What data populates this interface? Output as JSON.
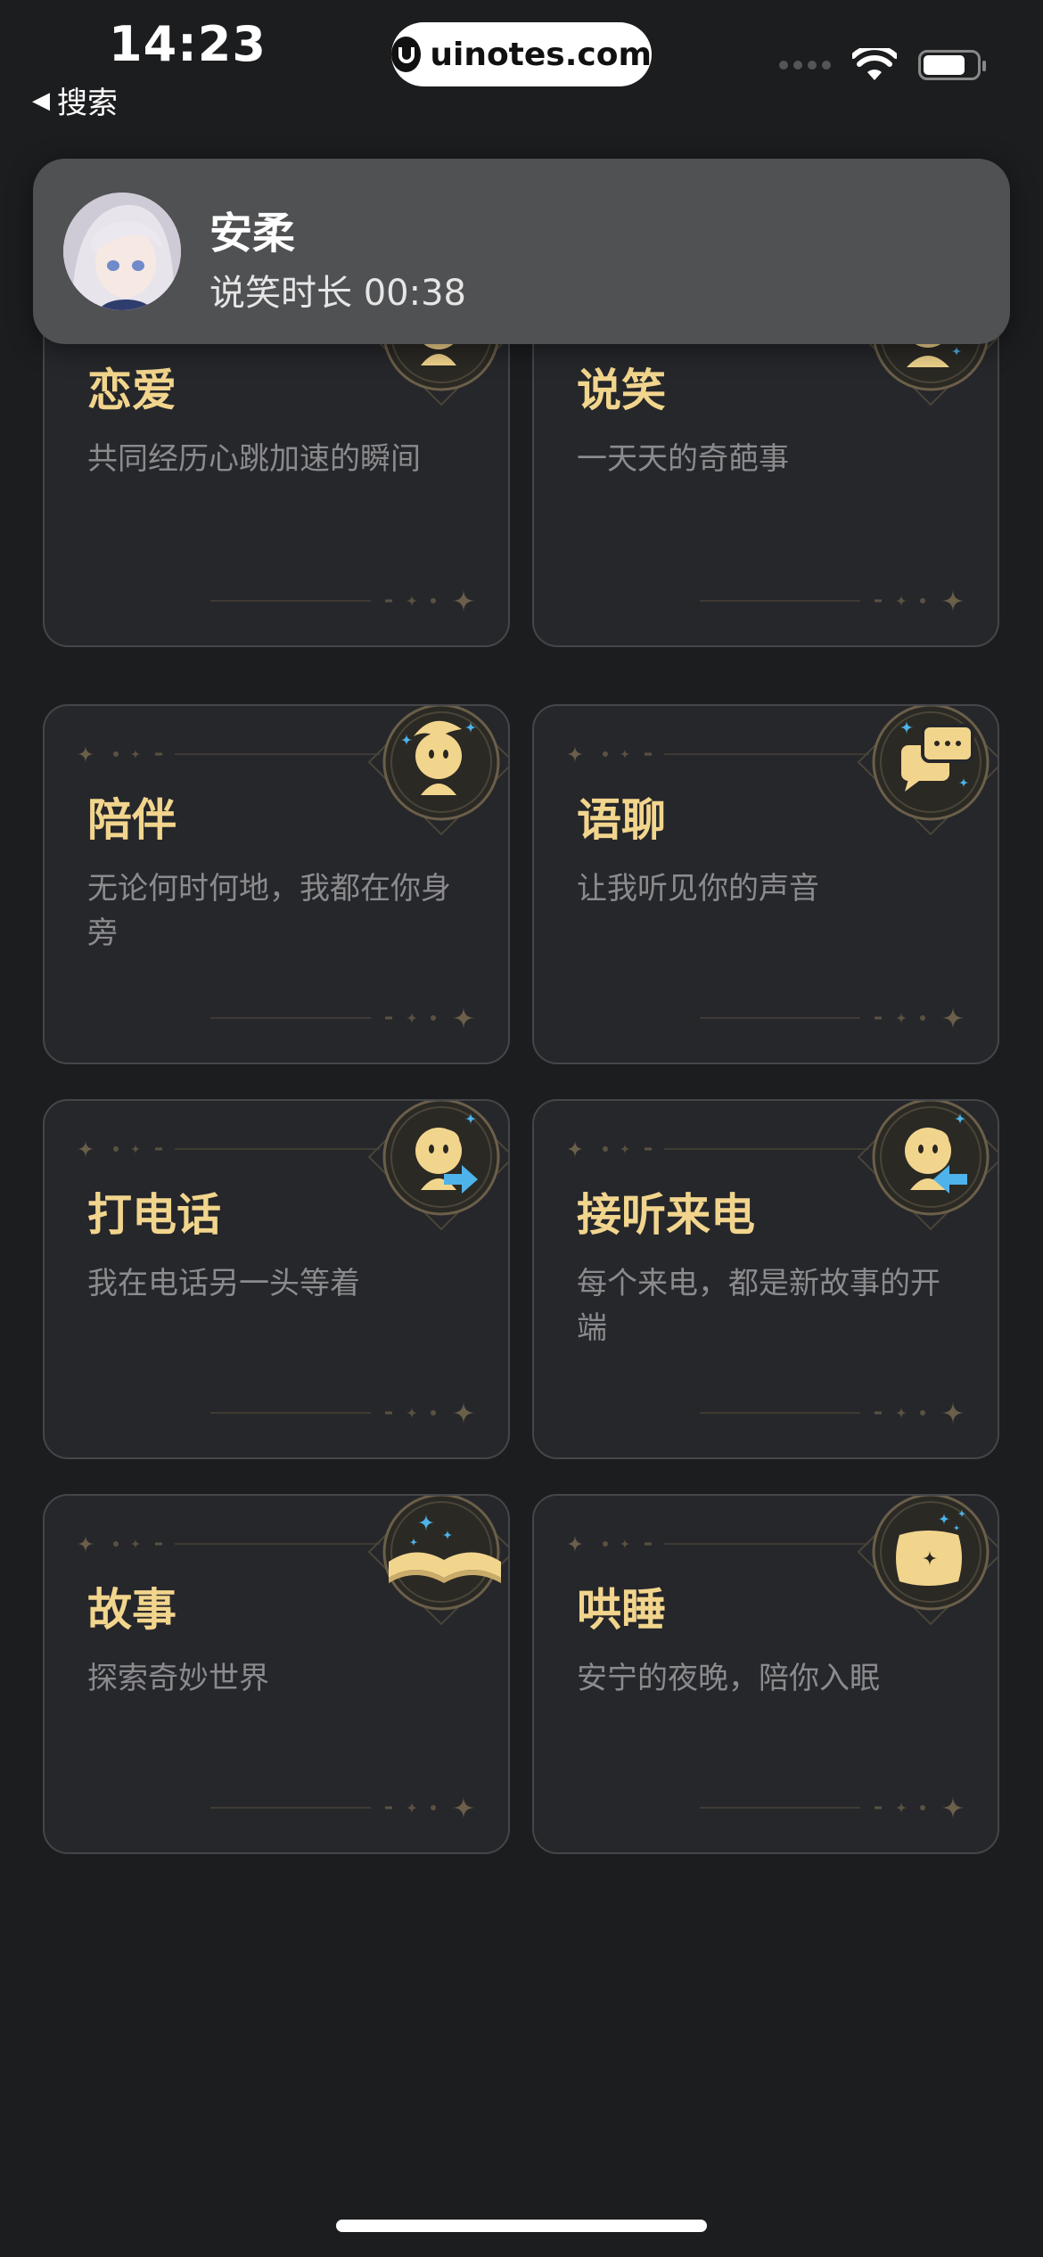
{
  "status_bar": {
    "time": "14:23",
    "back_label": "搜索",
    "watermark": "uinotes.com"
  },
  "notification": {
    "name": "安柔",
    "subtitle": "说笑时长 00:38"
  },
  "cards": [
    {
      "title": "恋爱",
      "desc": "共同经历心跳加速的瞬间",
      "icon": "love-figure-icon"
    },
    {
      "title": "说笑",
      "desc": "一天天的奇葩事",
      "icon": "laughing-figure-icon"
    },
    {
      "title": "陪伴",
      "desc": "无论何时何地，我都在你身旁",
      "icon": "companion-figure-icon"
    },
    {
      "title": "语聊",
      "desc": "让我听见你的声音",
      "icon": "chat-bubbles-icon"
    },
    {
      "title": "打电话",
      "desc": "我在电话另一头等着",
      "icon": "outgoing-call-icon"
    },
    {
      "title": "接听来电",
      "desc": "每个来电，都是新故事的开端",
      "icon": "incoming-call-icon"
    },
    {
      "title": "故事",
      "desc": "探索奇妙世界",
      "icon": "open-book-icon"
    },
    {
      "title": "哄睡",
      "desc": "安宁的夜晚，陪你入眠",
      "icon": "pillow-icon"
    }
  ],
  "colors": {
    "background": "#1c1d1f",
    "card": "#26272b",
    "accent_gold": "#f2d58d",
    "accent_blue": "#4db3ea"
  }
}
